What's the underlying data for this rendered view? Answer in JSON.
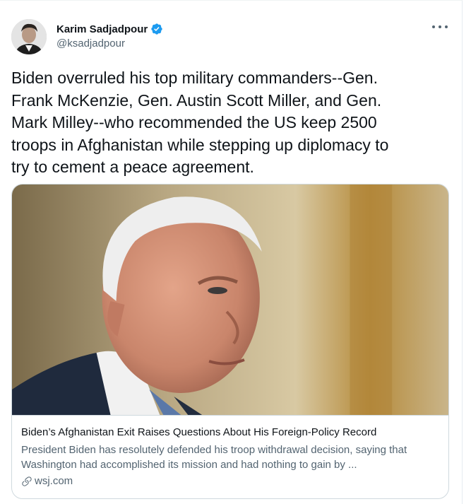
{
  "author": {
    "name": "Karim Sadjadpour",
    "handle": "@ksadjadpour",
    "verified": true,
    "avatar_icon": "profile-photo"
  },
  "tweet": {
    "text": "Biden overruled his top military commanders--Gen.\nFrank McKenzie, Gen. Austin Scott Miller, and Gen.\nMark Milley--who recommended the US keep 2500\ntroops in Afghanistan while stepping up diplomacy to\ntry to cement a peace agreement."
  },
  "card": {
    "image_icon": "portrait-photo",
    "title": "Biden’s Afghanistan Exit Raises Questions About His Foreign-Policy Record",
    "description": "President Biden has resolutely defended his troop withdrawal decision, saying that Washington had accomplished its mission and had nothing to gain by ...",
    "domain": "wsj.com"
  },
  "colors": {
    "text_primary": "#0f1419",
    "text_secondary": "#536471",
    "verified_badge": "#1d9bf0",
    "border": "#cfd9de"
  }
}
